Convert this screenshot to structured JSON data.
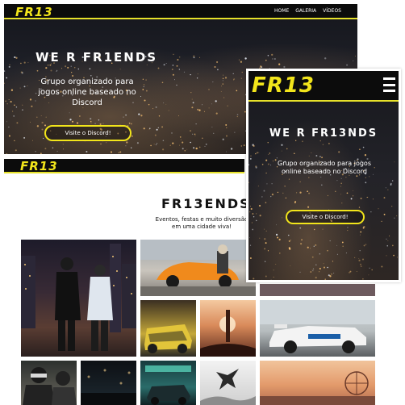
{
  "desktop": {
    "logo": "FR13",
    "nav": [
      "HOME",
      "GALERIA",
      "VÍDEOS"
    ],
    "hero_title": "WE R FR1ENDS",
    "hero_subtitle": "Grupo organizado para jogos online baseado no Discord",
    "hero_button": "Visite o Discord!"
  },
  "gallery": {
    "logo": "FR13",
    "title": "FR13ENDS",
    "subtitle": "Eventos, festas e muito diversão em uma cidade viva!",
    "tiles": [
      "photo-friends-city",
      "photo-orange-supercar",
      "photo-yellow-car",
      "photo-sunset-monument",
      "photo-white-racecar",
      "photo-masked-group",
      "photo-dark-street",
      "photo-teal-garage",
      "photo-jump",
      "photo-ferris-wheel",
      "photo-partial"
    ]
  },
  "mobile": {
    "logo": "FR13",
    "hero_title": "WE R FR13NDS",
    "hero_subtitle": "Grupo organizado para jogos online baseado no Discord",
    "hero_button": "Visite o Discord!",
    "menu_icon": "hamburger-menu-icon"
  },
  "colors": {
    "accent": "#f2e51b",
    "nav_bg": "#0c0c0c",
    "text_light": "#ffffff",
    "text_dark": "#111111"
  }
}
